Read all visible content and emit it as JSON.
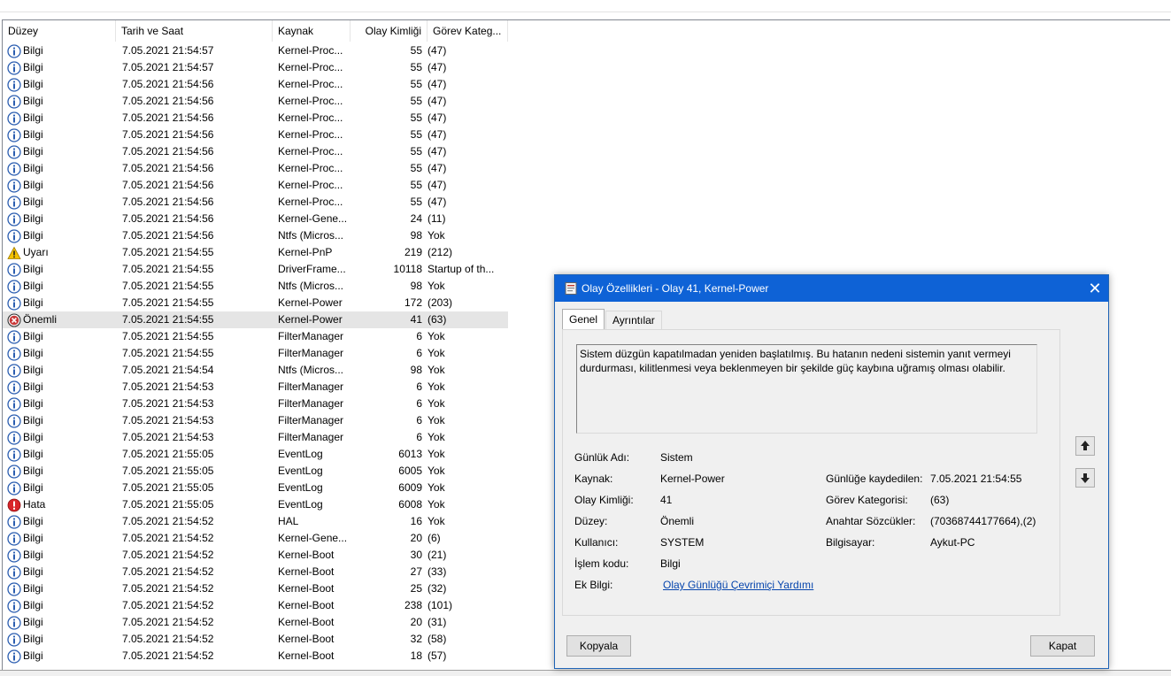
{
  "columns": [
    "Düzey",
    "Tarih ve Saat",
    "Kaynak",
    "Olay Kimliği",
    "Görev Kateg..."
  ],
  "rows": [
    {
      "level": "Bilgi",
      "icon": "info-icon",
      "datetime": "7.05.2021 21:54:57",
      "source": "Kernel-Proc...",
      "id": "55",
      "category": "(47)"
    },
    {
      "level": "Bilgi",
      "icon": "info-icon",
      "datetime": "7.05.2021 21:54:57",
      "source": "Kernel-Proc...",
      "id": "55",
      "category": "(47)"
    },
    {
      "level": "Bilgi",
      "icon": "info-icon",
      "datetime": "7.05.2021 21:54:56",
      "source": "Kernel-Proc...",
      "id": "55",
      "category": "(47)"
    },
    {
      "level": "Bilgi",
      "icon": "info-icon",
      "datetime": "7.05.2021 21:54:56",
      "source": "Kernel-Proc...",
      "id": "55",
      "category": "(47)"
    },
    {
      "level": "Bilgi",
      "icon": "info-icon",
      "datetime": "7.05.2021 21:54:56",
      "source": "Kernel-Proc...",
      "id": "55",
      "category": "(47)"
    },
    {
      "level": "Bilgi",
      "icon": "info-icon",
      "datetime": "7.05.2021 21:54:56",
      "source": "Kernel-Proc...",
      "id": "55",
      "category": "(47)"
    },
    {
      "level": "Bilgi",
      "icon": "info-icon",
      "datetime": "7.05.2021 21:54:56",
      "source": "Kernel-Proc...",
      "id": "55",
      "category": "(47)"
    },
    {
      "level": "Bilgi",
      "icon": "info-icon",
      "datetime": "7.05.2021 21:54:56",
      "source": "Kernel-Proc...",
      "id": "55",
      "category": "(47)"
    },
    {
      "level": "Bilgi",
      "icon": "info-icon",
      "datetime": "7.05.2021 21:54:56",
      "source": "Kernel-Proc...",
      "id": "55",
      "category": "(47)"
    },
    {
      "level": "Bilgi",
      "icon": "info-icon",
      "datetime": "7.05.2021 21:54:56",
      "source": "Kernel-Proc...",
      "id": "55",
      "category": "(47)"
    },
    {
      "level": "Bilgi",
      "icon": "info-icon",
      "datetime": "7.05.2021 21:54:56",
      "source": "Kernel-Gene...",
      "id": "24",
      "category": "(11)"
    },
    {
      "level": "Bilgi",
      "icon": "info-icon",
      "datetime": "7.05.2021 21:54:56",
      "source": "Ntfs (Micros...",
      "id": "98",
      "category": "Yok"
    },
    {
      "level": "Uyarı",
      "icon": "warning-icon",
      "datetime": "7.05.2021 21:54:55",
      "source": "Kernel-PnP",
      "id": "219",
      "category": "(212)"
    },
    {
      "level": "Bilgi",
      "icon": "info-icon",
      "datetime": "7.05.2021 21:54:55",
      "source": "DriverFrame...",
      "id": "10118",
      "category": "Startup of th..."
    },
    {
      "level": "Bilgi",
      "icon": "info-icon",
      "datetime": "7.05.2021 21:54:55",
      "source": "Ntfs (Micros...",
      "id": "98",
      "category": "Yok"
    },
    {
      "level": "Bilgi",
      "icon": "info-icon",
      "datetime": "7.05.2021 21:54:55",
      "source": "Kernel-Power",
      "id": "172",
      "category": "(203)"
    },
    {
      "level": "Önemli",
      "icon": "critical-icon",
      "datetime": "7.05.2021 21:54:55",
      "source": "Kernel-Power",
      "id": "41",
      "category": "(63)",
      "selected": true
    },
    {
      "level": "Bilgi",
      "icon": "info-icon",
      "datetime": "7.05.2021 21:54:55",
      "source": "FilterManager",
      "id": "6",
      "category": "Yok"
    },
    {
      "level": "Bilgi",
      "icon": "info-icon",
      "datetime": "7.05.2021 21:54:55",
      "source": "FilterManager",
      "id": "6",
      "category": "Yok"
    },
    {
      "level": "Bilgi",
      "icon": "info-icon",
      "datetime": "7.05.2021 21:54:54",
      "source": "Ntfs (Micros...",
      "id": "98",
      "category": "Yok"
    },
    {
      "level": "Bilgi",
      "icon": "info-icon",
      "datetime": "7.05.2021 21:54:53",
      "source": "FilterManager",
      "id": "6",
      "category": "Yok"
    },
    {
      "level": "Bilgi",
      "icon": "info-icon",
      "datetime": "7.05.2021 21:54:53",
      "source": "FilterManager",
      "id": "6",
      "category": "Yok"
    },
    {
      "level": "Bilgi",
      "icon": "info-icon",
      "datetime": "7.05.2021 21:54:53",
      "source": "FilterManager",
      "id": "6",
      "category": "Yok"
    },
    {
      "level": "Bilgi",
      "icon": "info-icon",
      "datetime": "7.05.2021 21:54:53",
      "source": "FilterManager",
      "id": "6",
      "category": "Yok"
    },
    {
      "level": "Bilgi",
      "icon": "info-icon",
      "datetime": "7.05.2021 21:55:05",
      "source": "EventLog",
      "id": "6013",
      "category": "Yok"
    },
    {
      "level": "Bilgi",
      "icon": "info-icon",
      "datetime": "7.05.2021 21:55:05",
      "source": "EventLog",
      "id": "6005",
      "category": "Yok"
    },
    {
      "level": "Bilgi",
      "icon": "info-icon",
      "datetime": "7.05.2021 21:55:05",
      "source": "EventLog",
      "id": "6009",
      "category": "Yok"
    },
    {
      "level": "Hata",
      "icon": "error-icon",
      "datetime": "7.05.2021 21:55:05",
      "source": "EventLog",
      "id": "6008",
      "category": "Yok"
    },
    {
      "level": "Bilgi",
      "icon": "info-icon",
      "datetime": "7.05.2021 21:54:52",
      "source": "HAL",
      "id": "16",
      "category": "Yok"
    },
    {
      "level": "Bilgi",
      "icon": "info-icon",
      "datetime": "7.05.2021 21:54:52",
      "source": "Kernel-Gene...",
      "id": "20",
      "category": "(6)"
    },
    {
      "level": "Bilgi",
      "icon": "info-icon",
      "datetime": "7.05.2021 21:54:52",
      "source": "Kernel-Boot",
      "id": "30",
      "category": "(21)"
    },
    {
      "level": "Bilgi",
      "icon": "info-icon",
      "datetime": "7.05.2021 21:54:52",
      "source": "Kernel-Boot",
      "id": "27",
      "category": "(33)"
    },
    {
      "level": "Bilgi",
      "icon": "info-icon",
      "datetime": "7.05.2021 21:54:52",
      "source": "Kernel-Boot",
      "id": "25",
      "category": "(32)"
    },
    {
      "level": "Bilgi",
      "icon": "info-icon",
      "datetime": "7.05.2021 21:54:52",
      "source": "Kernel-Boot",
      "id": "238",
      "category": "(101)"
    },
    {
      "level": "Bilgi",
      "icon": "info-icon",
      "datetime": "7.05.2021 21:54:52",
      "source": "Kernel-Boot",
      "id": "20",
      "category": "(31)"
    },
    {
      "level": "Bilgi",
      "icon": "info-icon",
      "datetime": "7.05.2021 21:54:52",
      "source": "Kernel-Boot",
      "id": "32",
      "category": "(58)"
    },
    {
      "level": "Bilgi",
      "icon": "info-icon",
      "datetime": "7.05.2021 21:54:52",
      "source": "Kernel-Boot",
      "id": "18",
      "category": "(57)"
    }
  ],
  "dialog": {
    "title": "Olay Özellikleri - Olay 41, Kernel-Power",
    "close_glyph": "✕",
    "tabs": [
      "Genel",
      "Ayrıntılar"
    ],
    "description": "Sistem düzgün kapatılmadan yeniden başlatılmış. Bu hatanın nedeni sistemin yanıt vermeyi durdurması, kilitlenmesi veya beklenmeyen bir şekilde güç kaybına uğramış olması olabilir.",
    "labels": {
      "log_name": "Günlük Adı:",
      "source": "Kaynak:",
      "event_id": "Olay Kimliği:",
      "level": "Düzey:",
      "user": "Kullanıcı:",
      "opcode": "İşlem kodu:",
      "more_info": "Ek Bilgi:",
      "logged": "Günlüğe kaydedilen:",
      "task_category": "Görev Kategorisi:",
      "keywords": "Anahtar Sözcükler:",
      "computer": "Bilgisayar:"
    },
    "values": {
      "log_name": "Sistem",
      "source": "Kernel-Power",
      "event_id": "41",
      "level": "Önemli",
      "user": "SYSTEM",
      "opcode": "Bilgi",
      "more_info_link": "Olay Günlüğü Çevrimiçi Yardımı",
      "logged": "7.05.2021 21:54:55",
      "task_category": "(63)",
      "keywords": "(70368744177664),(2)",
      "computer": "Aykut-PC"
    },
    "buttons": {
      "copy": "Kopyala",
      "close": "Kapat"
    },
    "nav": {
      "up_icon": "arrow-up-icon",
      "down_icon": "arrow-down-icon"
    }
  },
  "colors": {
    "titlebar": "#0e62d6",
    "selection": "#e5e5e5",
    "link": "#0645ad",
    "info": "#2a5db0",
    "warning": "#f4c200",
    "error": "#d9252a"
  }
}
